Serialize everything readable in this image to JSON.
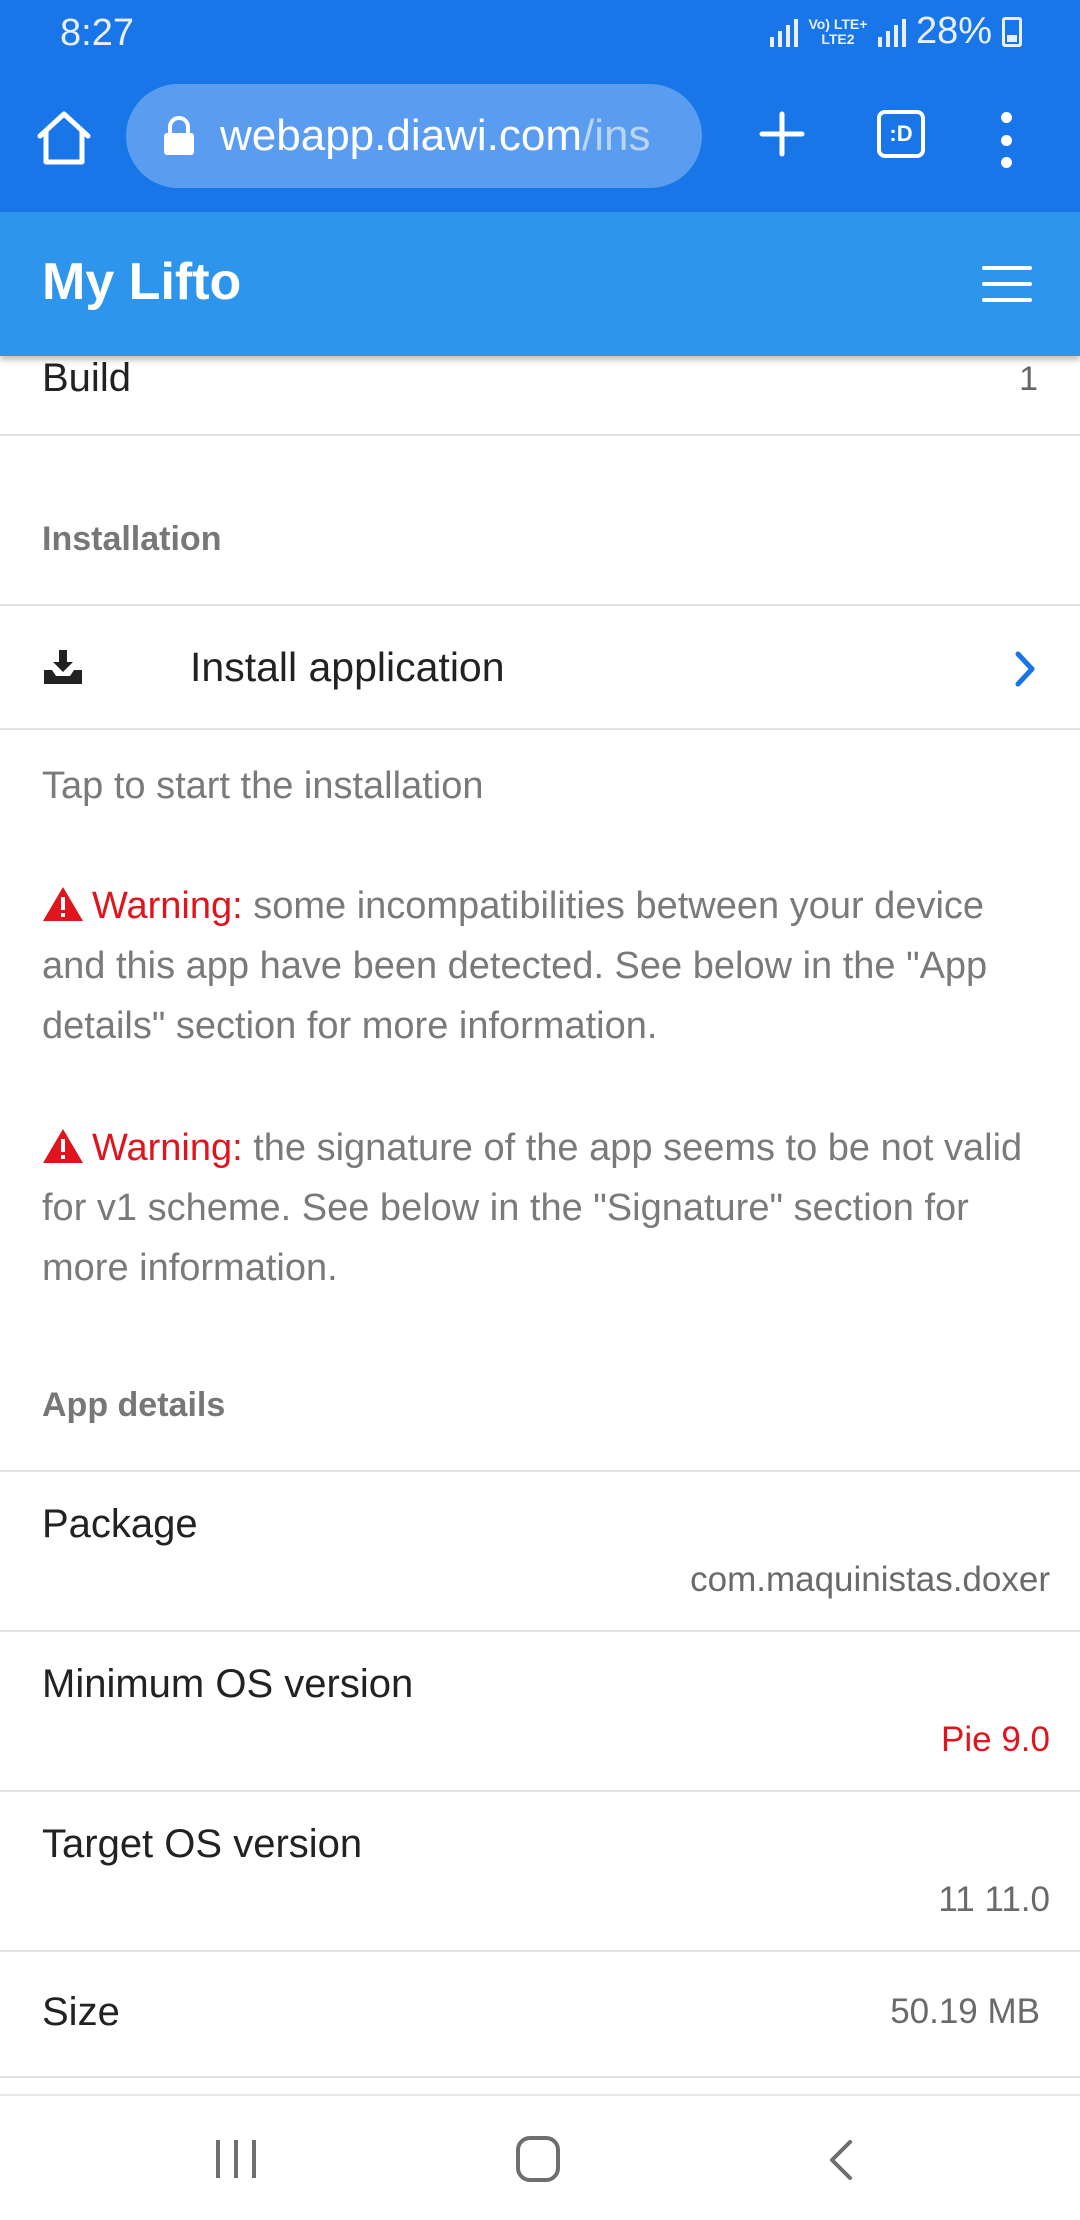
{
  "status_bar": {
    "time": "8:27",
    "network_label": "Vo) LTE+ LTE2",
    "battery": "28%"
  },
  "browser": {
    "url_host": "webapp.diawi.com",
    "url_rest": "/ins",
    "tabs_label": ":D"
  },
  "app_bar": {
    "title": "My Lifto"
  },
  "build_row": {
    "label": "Build",
    "value": "1"
  },
  "installation": {
    "section_title": "Installation",
    "install_label": "Install application",
    "hint": "Tap to start the installation",
    "warning_label": "Warning:",
    "warning1_text": " some incompatibilities between your device and this app have been detected. See below in the \"App details\" section for more information.",
    "warning2_text": " the signature of the app seems to be not valid for v1 scheme. See below in the \"Signature\" section for more information."
  },
  "app_details": {
    "section_title": "App details",
    "rows": [
      {
        "label": "Package",
        "value": "com.maquinistas.doxer"
      },
      {
        "label": "Minimum OS version",
        "value": "Pie 9.0"
      },
      {
        "label": "Target OS version",
        "value": "11 11.0"
      },
      {
        "label": "Size",
        "value": "50.19 MB"
      }
    ]
  },
  "colors": {
    "browser_bar": "#1976e8",
    "app_bar": "#2d95ec",
    "warning": "#e0141c",
    "chevron": "#1a73e8"
  }
}
